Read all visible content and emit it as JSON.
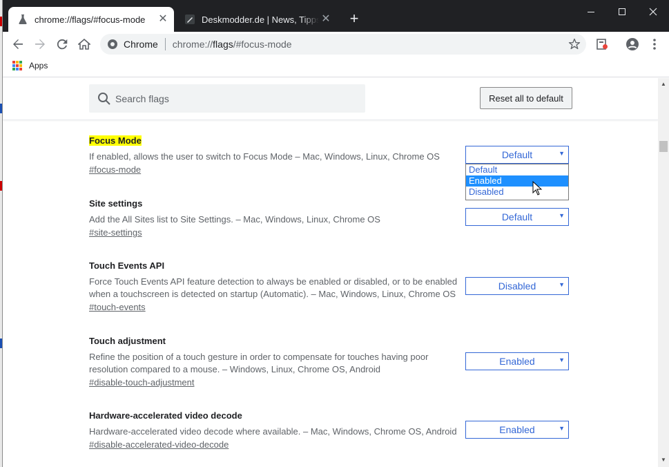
{
  "tabs": [
    {
      "title": "chrome://flags/#focus-mode",
      "active": true,
      "icon": "flask-icon"
    },
    {
      "title": "Deskmodder.de | News, Tipps und",
      "active": false,
      "icon": "pen-icon"
    }
  ],
  "window_controls": {
    "minimize": "minimize-icon",
    "maximize": "maximize-icon",
    "close": "close-icon"
  },
  "omnibox": {
    "scheme_label": "Chrome",
    "url_prefix": "chrome://",
    "url_bold": "flags",
    "url_suffix": "/#focus-mode"
  },
  "bookmarks": {
    "apps_label": "Apps"
  },
  "header": {
    "search_placeholder": "Search flags",
    "reset_label": "Reset all to default"
  },
  "flags": [
    {
      "name": "Focus Mode",
      "highlighted": true,
      "description": "If enabled, allows the user to switch to Focus Mode – Mac, Windows, Linux, Chrome OS",
      "link": "#focus-mode",
      "value": "Default"
    },
    {
      "name": "Site settings",
      "highlighted": false,
      "description": "Add the All Sites list to Site Settings. – Mac, Windows, Linux, Chrome OS",
      "link": "#site-settings",
      "value": "Default"
    },
    {
      "name": "Touch Events API",
      "highlighted": false,
      "description": "Force Touch Events API feature detection to always be enabled or disabled, or to be enabled when a touchscreen is detected on startup (Automatic). – Mac, Windows, Linux, Chrome OS",
      "link": "#touch-events",
      "value": "Disabled"
    },
    {
      "name": "Touch adjustment",
      "highlighted": false,
      "description": "Refine the position of a touch gesture in order to compensate for touches having poor resolution compared to a mouse. – Windows, Linux, Chrome OS, Android",
      "link": "#disable-touch-adjustment",
      "value": "Enabled"
    },
    {
      "name": "Hardware-accelerated video decode",
      "highlighted": false,
      "description": "Hardware-accelerated video decode where available. – Mac, Windows, Chrome OS, Android",
      "link": "#disable-accelerated-video-decode",
      "value": "Enabled"
    }
  ],
  "dropdown": {
    "options": [
      "Default",
      "Enabled",
      "Disabled"
    ],
    "hovered": "Enabled"
  },
  "colors": {
    "accent": "#3367d6",
    "highlight": "#ffff00",
    "selected_option": "#1e90ff",
    "tabbar": "#202124"
  }
}
